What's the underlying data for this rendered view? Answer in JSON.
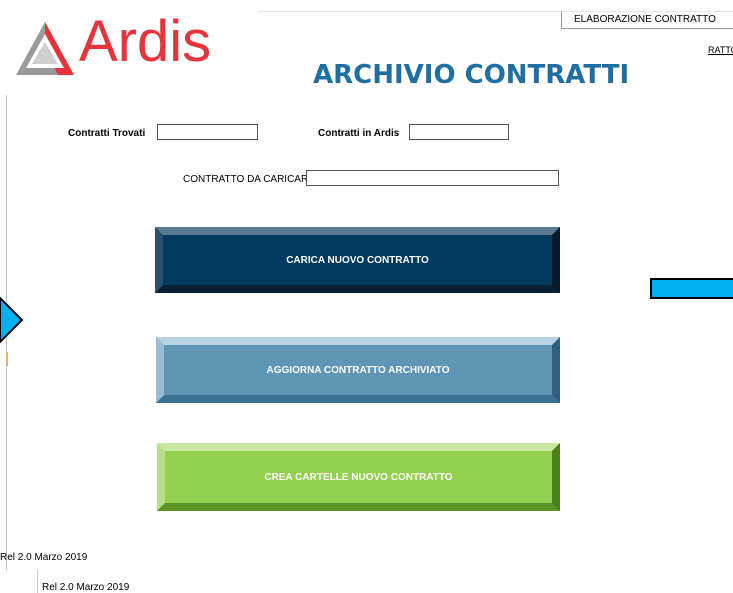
{
  "header": {
    "logo_text": "Ardis",
    "tab_elaborazione": "ELABORAZIONE CONTRATTO",
    "tab_partial": "RATTO",
    "title": "ARCHIVIO CONTRATTI"
  },
  "form": {
    "contratti_trovati_label": "Contratti Trovati",
    "contratti_trovati_value": "",
    "contratti_ardis_label": "Contratti in Ardis",
    "contratti_ardis_value": "",
    "contratto_da_caricare_label": "CONTRATTO DA CARICARE",
    "contratto_da_caricare_value": ""
  },
  "buttons": {
    "carica": "CARICA NUOVO CONTRATTO",
    "aggiorna": "AGGIORNA CONTRATTO ARCHIVIATO",
    "crea": "CREA CARTELLE NUOVO CONTRATTO"
  },
  "footer": {
    "release_1": "Rel 2.0 Marzo 2019",
    "release_2": "Rel 2.0 Marzo 2019"
  },
  "colors": {
    "title": "#1f6ea4",
    "logo": "#e8333a",
    "carica_button": "#003a60",
    "aggiorna_button": "#5f96b5",
    "crea_button": "#92d050",
    "nav_shapes": "#00b0f0"
  }
}
